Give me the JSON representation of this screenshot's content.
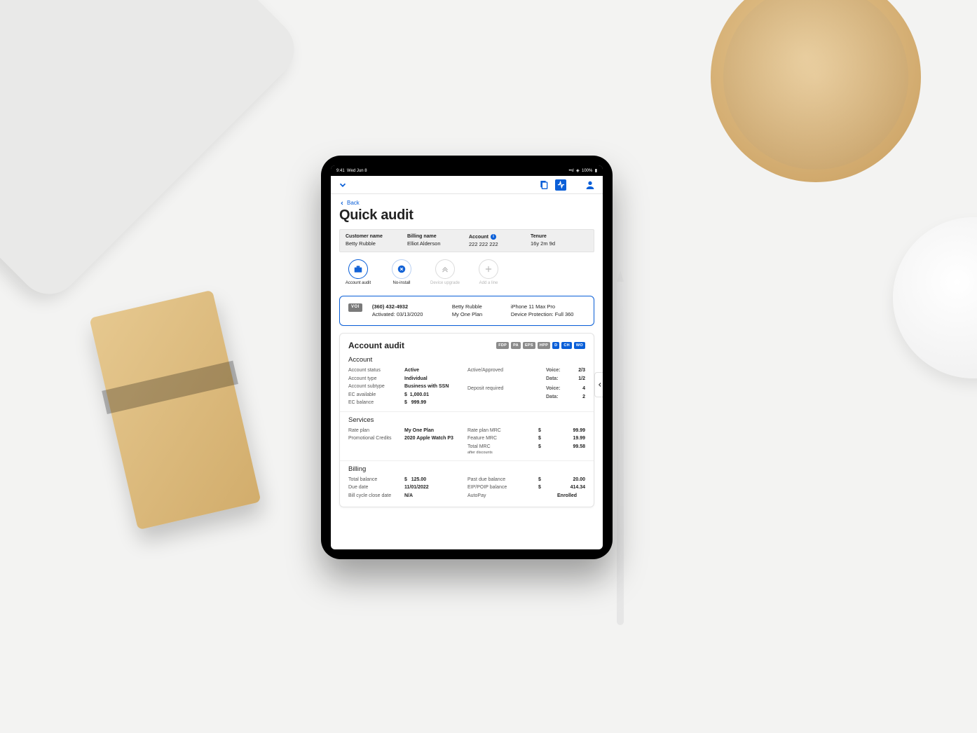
{
  "statusbar": {
    "time": "9:41",
    "date": "Wed Jun 8",
    "battery": "100%"
  },
  "back_label": "Back",
  "page_title": "Quick audit",
  "info": {
    "customer_name_label": "Customer name",
    "customer_name": "Betty Rubble",
    "billing_name_label": "Billing name",
    "billing_name": "Elliot Alderson",
    "account_label": "Account",
    "account": "222 222 222",
    "tenure_label": "Tenure",
    "tenure": "16y 2m 9d"
  },
  "actions": {
    "account_audit": "Account audit",
    "no_install": "No-install",
    "device_upgrade": "Device upgrade",
    "add_a_line": "Add a line"
  },
  "line": {
    "voi": "VOI",
    "phone": "(360) 432-4932",
    "activated": "Activated: 03/13/2020",
    "name": "Betty Rubble",
    "plan": "My One Plan",
    "device": "iPhone 11 Max Pro",
    "protection": "Device Protection: Full 360"
  },
  "audit_title": "Account audit",
  "badges": [
    "FDP",
    "PA",
    "EPS",
    "HPP",
    "D",
    "CH",
    "WO"
  ],
  "badge_blue": [
    false,
    false,
    false,
    false,
    true,
    true,
    true
  ],
  "account": {
    "section": "Account",
    "status_l": "Account status",
    "status_v": "Active",
    "type_l": "Account type",
    "type_v": "Individual",
    "subtype_l": "Account subtype",
    "subtype_v": "Business with SSN",
    "ec_avail_l": "EC available",
    "ec_avail_v": "1,000.01",
    "ec_bal_l": "EC balance",
    "ec_bal_v": "999.99",
    "active_l": "Active/Approved",
    "voice_l": "Voice:",
    "voice_v": "2/3",
    "data_l": "Data:",
    "data_v": "1/2",
    "deposit_l": "Deposit required",
    "dep_voice_v": "4",
    "dep_data_v": "2"
  },
  "services": {
    "section": "Services",
    "rate_l": "Rate plan",
    "rate_v": "My One Plan",
    "promo_l": "Promotional Credits",
    "promo_v": "2020 Apple Watch P3",
    "rate_mrc_l": "Rate plan MRC",
    "rate_mrc_v": "99.99",
    "feat_mrc_l": "Feature MRC",
    "feat_mrc_v": "19.99",
    "total_mrc_l": "Total MRC",
    "total_mrc_v": "99.58",
    "after": "after discounts"
  },
  "billing": {
    "section": "Billing",
    "total_l": "Total balance",
    "total_v": "125.00",
    "due_l": "Due date",
    "due_v": "11/01/2022",
    "cycle_l": "Bill cycle close date",
    "cycle_v": "N/A",
    "past_l": "Past due balance",
    "past_v": "20.00",
    "eip_l": "EIP/POIP balance",
    "eip_v": "414.34",
    "auto_l": "AutoPay",
    "auto_v": "Enrolled"
  },
  "dollar": "$"
}
